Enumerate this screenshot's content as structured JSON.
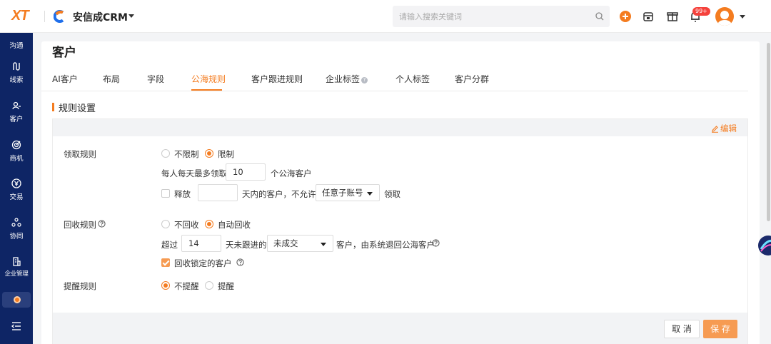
{
  "topbar": {
    "logo": "XT",
    "app_name": "安信成CRM",
    "search_placeholder": "请输入搜索关键词",
    "notification_badge": "99+",
    "icons": [
      "search-icon",
      "add-icon",
      "store-icon",
      "gift-icon",
      "bell-icon",
      "avatar"
    ]
  },
  "sidebar": {
    "items": [
      {
        "label": "沟通",
        "icon": "chat-icon"
      },
      {
        "label": "线索",
        "icon": "clue-icon"
      },
      {
        "label": "客户",
        "icon": "customer-icon"
      },
      {
        "label": "商机",
        "icon": "target-icon"
      },
      {
        "label": "交易",
        "icon": "yen-icon"
      },
      {
        "label": "协同",
        "icon": "collab-icon"
      },
      {
        "label": "企业管理",
        "icon": "building-icon"
      }
    ]
  },
  "page": {
    "title": "客户",
    "tabs": [
      {
        "label": "AI客户",
        "active": false
      },
      {
        "label": "布局",
        "active": false
      },
      {
        "label": "字段",
        "active": false
      },
      {
        "label": "公海规则",
        "active": true
      },
      {
        "label": "客户跟进规则",
        "active": false
      },
      {
        "label": "企业标签",
        "active": false,
        "help": true
      },
      {
        "label": "个人标签",
        "active": false
      },
      {
        "label": "客户分群",
        "active": false
      }
    ],
    "section_title": "规则设置",
    "edit_label": "编辑"
  },
  "rules": {
    "claim": {
      "label": "领取规则",
      "options": [
        "不限制",
        "限制"
      ],
      "selected": "限制",
      "daily_prefix": "每人每天最多领取",
      "daily_value": "10",
      "daily_suffix": "个公海客户",
      "release_label": "释放",
      "release_checked": false,
      "release_days": "",
      "release_mid": "天内的客户，不允许",
      "release_account": "任意子账号",
      "release_suffix": "领取"
    },
    "recycle": {
      "label": "回收规则",
      "options": [
        "不回收",
        "自动回收"
      ],
      "selected": "自动回收",
      "prefix": "超过",
      "days": "14",
      "mid": "天未跟进的",
      "status": "未成交",
      "suffix": "客户，由系统退回公海客户",
      "locked_label": "回收锁定的客户",
      "locked_checked": true
    },
    "remind": {
      "label": "提醒规则",
      "options": [
        "不提醒",
        "提醒"
      ],
      "selected": "不提醒"
    }
  },
  "actions": {
    "cancel": "取 消",
    "save": "保 存"
  },
  "colors": {
    "accent": "#f47c20",
    "sidebar": "#0e2565",
    "save_button": "#f69b52"
  }
}
